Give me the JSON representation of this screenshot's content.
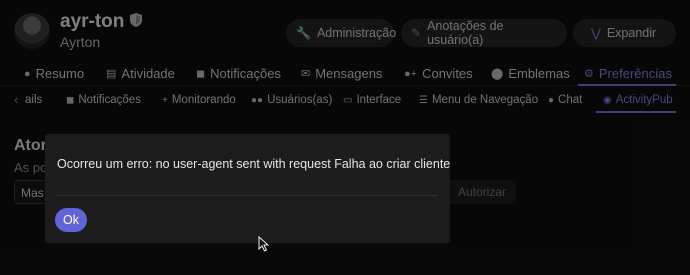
{
  "profile": {
    "username": "ayr-ton",
    "full_name": "Ayrton"
  },
  "header_buttons": [
    {
      "label": "Administração",
      "icon": "wrench-icon"
    },
    {
      "label": "Anotações de usuário(a)",
      "icon": "pencil-icon"
    },
    {
      "label": "Expandir",
      "icon": "double-chevron-down-icon"
    }
  ],
  "main_tabs": [
    {
      "label": "Resumo",
      "icon": "user-icon"
    },
    {
      "label": "Atividade",
      "icon": "stream-icon"
    },
    {
      "label": "Notificações",
      "icon": "bell-icon"
    },
    {
      "label": "Mensagens",
      "icon": "envelope-icon"
    },
    {
      "label": "Convites",
      "icon": "user-plus-icon"
    },
    {
      "label": "Emblemas",
      "icon": "certificate-icon"
    },
    {
      "label": "Preferências",
      "icon": "gear-icon",
      "active": true
    }
  ],
  "sub_tabs": [
    {
      "label": "ails",
      "icon": ""
    },
    {
      "label": "Notificações",
      "icon": "bell-icon"
    },
    {
      "label": "Monitorando",
      "icon": "plus-icon"
    },
    {
      "label": "Usuários(as)",
      "icon": "users-icon"
    },
    {
      "label": "Interface",
      "icon": "desktop-icon"
    },
    {
      "label": "Menu de Navegação",
      "icon": "bars-icon"
    },
    {
      "label": "Chat",
      "icon": "comment-icon"
    },
    {
      "label": "ActivityPub",
      "icon": "eye-icon",
      "active": true
    }
  ],
  "background": {
    "heading": "Ator",
    "subtitle": "As po",
    "select_value": "Mas",
    "authorize_label": "Autorizar"
  },
  "modal": {
    "message": "Ocorreu um erro: no user-agent sent with request Falha ao criar cliente",
    "ok_label": "Ok"
  },
  "colors": {
    "accent": "#6d73d8",
    "ok_button": "#6164d6",
    "background": "#0e0e0e",
    "modal_background": "#1c1c1c"
  }
}
